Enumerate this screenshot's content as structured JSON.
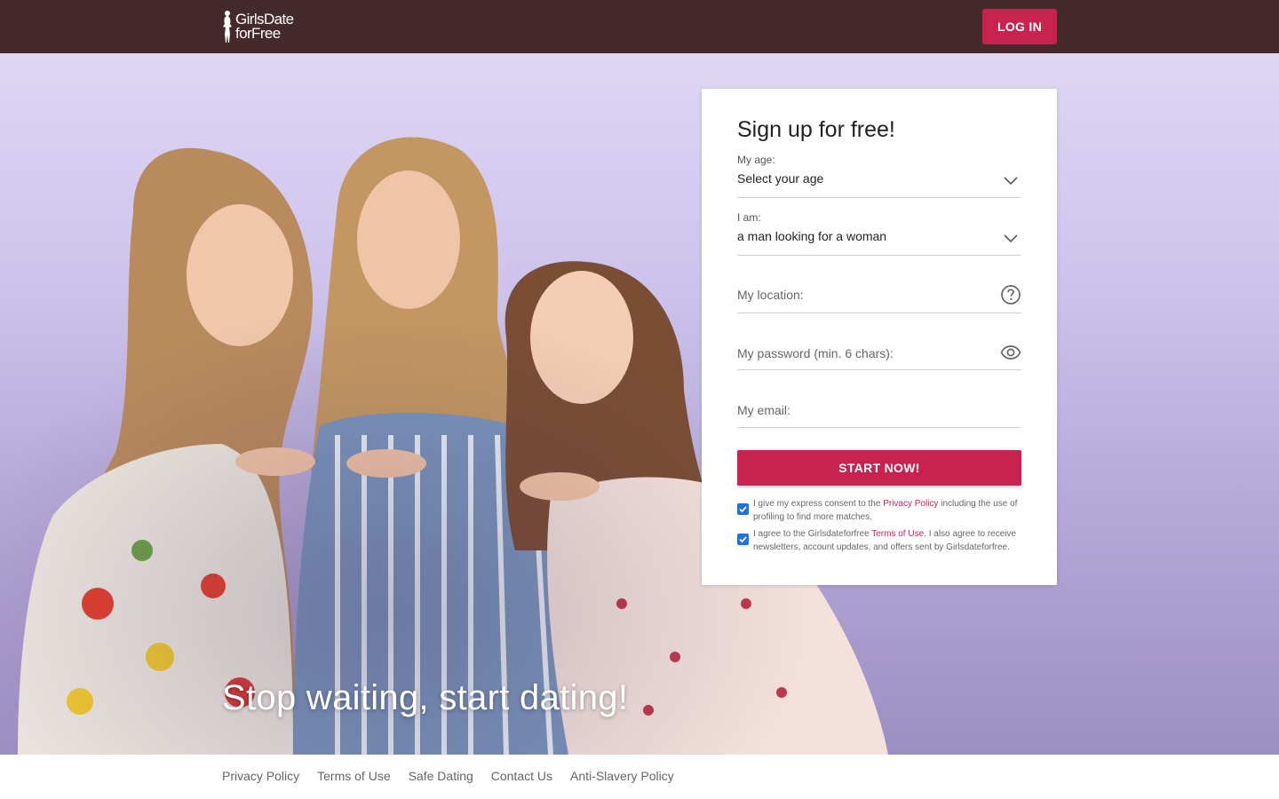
{
  "header": {
    "logo_line1": "GirlsDate",
    "logo_line2": "forFree",
    "login_label": "LOG IN"
  },
  "hero": {
    "tagline": "Stop waiting, start dating!"
  },
  "signup": {
    "title": "Sign up for free!",
    "age": {
      "label": "My age:",
      "value": "Select your age"
    },
    "iam": {
      "label": "I am:",
      "value": "a man looking for a woman"
    },
    "location": {
      "placeholder": "My location:"
    },
    "password": {
      "placeholder": "My password (min. 6 chars):"
    },
    "email": {
      "placeholder": "My email:"
    },
    "start_label": "START NOW!",
    "consent1": {
      "checked": true,
      "before": "I give my express consent to the ",
      "link": "Privacy Policy",
      "after": " including the use of profiling to find more matches."
    },
    "consent2": {
      "checked": true,
      "before": "I agree to the Girlsdateforfree ",
      "link": "Terms of Use",
      "after": ". I also agree to receive newsletters, account updates, and offers sent by Girlsdateforfree."
    }
  },
  "footer": {
    "links": [
      "Privacy Policy",
      "Terms of Use",
      "Safe Dating",
      "Contact Us",
      "Anti-Slavery Policy"
    ]
  },
  "colors": {
    "header_bg": "#452a2b",
    "accent": "#c8234f",
    "checkbox": "#1a73e8"
  },
  "icons": [
    "woman-silhouette-icon",
    "chevron-down-icon",
    "help-circle-icon",
    "eye-icon",
    "checkmark-icon"
  ]
}
